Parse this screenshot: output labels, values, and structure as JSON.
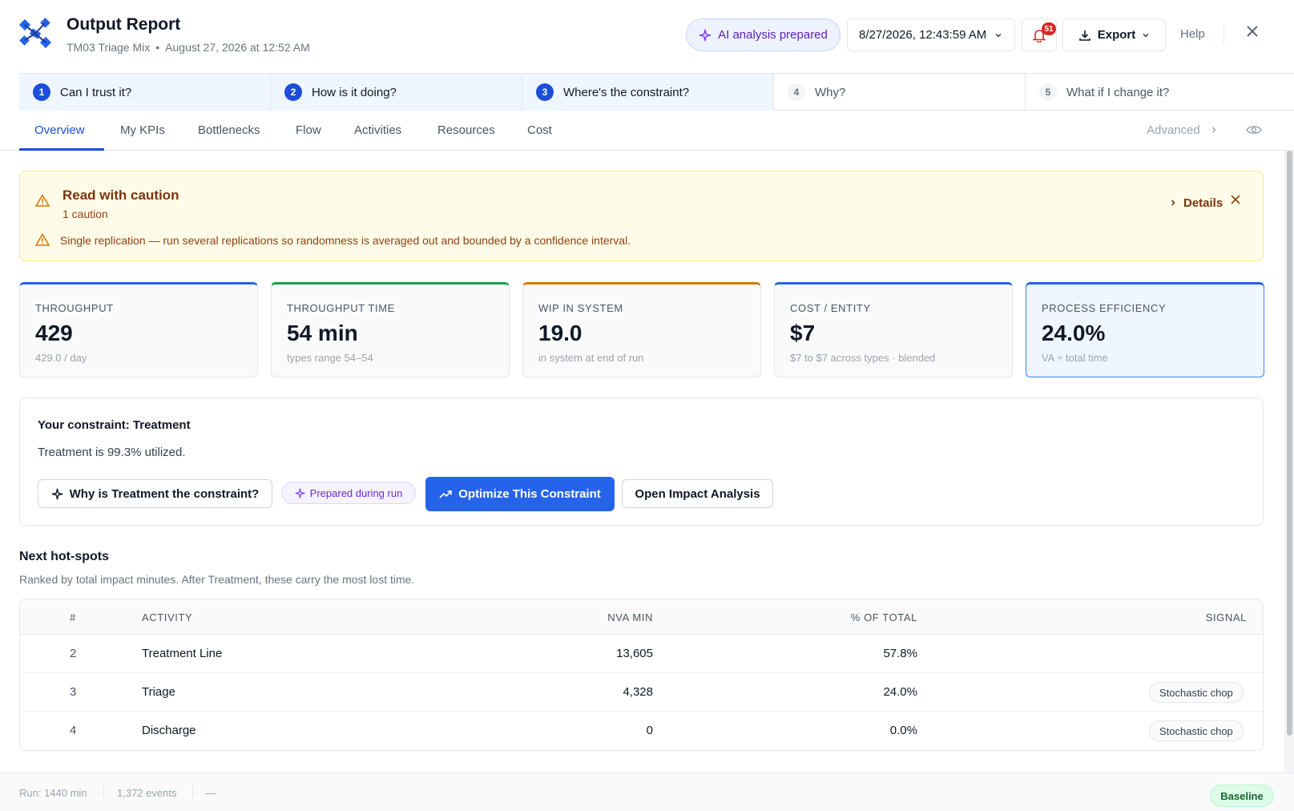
{
  "header": {
    "title": "Output Report",
    "scenario": "TM03 Triage Mix",
    "timestamp": "August 27, 2026 at 12:52 AM",
    "ai_pill": "AI analysis prepared",
    "date_select": "8/27/2026, 12:43:59 AM",
    "notification_count": "51",
    "export_label": "Export",
    "help_label": "Help"
  },
  "steps": [
    {
      "num": "1",
      "label": "Can I trust it?"
    },
    {
      "num": "2",
      "label": "How is it doing?"
    },
    {
      "num": "3",
      "label": "Where's the constraint?"
    },
    {
      "num": "4",
      "label": "Why?"
    },
    {
      "num": "5",
      "label": "What if I change it?"
    }
  ],
  "tabs": [
    "Overview",
    "My KPIs",
    "Bottlenecks",
    "Flow",
    "Activities",
    "Resources",
    "Cost"
  ],
  "advanced_label": "Advanced",
  "caution": {
    "title": "Read with caution",
    "count": "1 caution",
    "message": "Single replication — run several replications so randomness is averaged out and bounded by a confidence interval.",
    "details_label": "Details"
  },
  "kpis": [
    {
      "label": "THROUGHPUT",
      "value": "429",
      "sub": "429.0 / day",
      "accent": "#2563eb"
    },
    {
      "label": "THROUGHPUT TIME",
      "value": "54 min",
      "sub": "types range 54–54",
      "accent": "#16a34a"
    },
    {
      "label": "WIP IN SYSTEM",
      "value": "19.0",
      "sub": "in system at end of run",
      "accent": "#d97706"
    },
    {
      "label": "COST / ENTITY",
      "value": "$7",
      "sub": "$7 to $7 across types · blended",
      "accent": "#2563eb"
    },
    {
      "label": "PROCESS EFFICIENCY",
      "value": "24.0%",
      "sub": "VA ÷ total time",
      "accent": "#2563eb"
    }
  ],
  "constraint": {
    "title": "Your constraint: Treatment",
    "text": "Treatment is 99.3% utilized.",
    "why_button": "Why is Treatment the constraint?",
    "prepared_pill": "Prepared during run",
    "optimize_button": "Optimize This Constraint",
    "impact_button": "Open Impact Analysis"
  },
  "hotspots": {
    "title": "Next hot-spots",
    "subtitle": "Ranked by total impact minutes. After Treatment, these carry the most lost time.",
    "columns": [
      "#",
      "ACTIVITY",
      "NVA MIN",
      "% OF TOTAL",
      "SIGNAL"
    ],
    "rows": [
      {
        "rank": "2",
        "activity": "Treatment Line",
        "nva": "13,605",
        "pct": "57.8%",
        "signal": ""
      },
      {
        "rank": "3",
        "activity": "Triage",
        "nva": "4,328",
        "pct": "24.0%",
        "signal": "Stochastic chop"
      },
      {
        "rank": "4",
        "activity": "Discharge",
        "nva": "0",
        "pct": "0.0%",
        "signal": "Stochastic chop"
      }
    ]
  },
  "footer": {
    "run": "Run: 1440 min",
    "events": "1,372 events",
    "extra": "—",
    "baseline": "Baseline"
  }
}
